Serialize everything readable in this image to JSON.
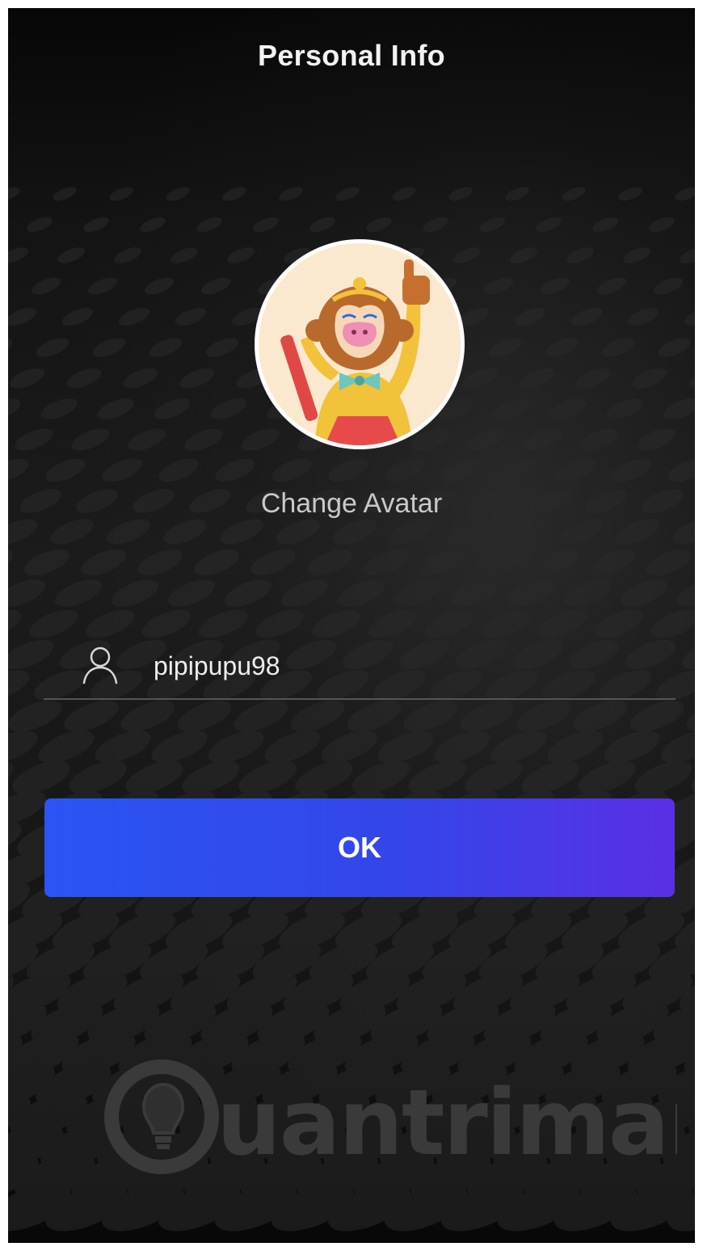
{
  "header": {
    "title": "Personal Info"
  },
  "avatar": {
    "alt": "monkey-king-avatar",
    "change_label": "Change Avatar"
  },
  "username_field": {
    "icon": "user-icon",
    "value": "pipipupu98"
  },
  "ok_button": {
    "label": "OK"
  },
  "watermark": {
    "text": "uantrimang",
    "icon": "lightbulb-icon"
  },
  "colors": {
    "background": "#151515",
    "button_start": "#2b54f4",
    "button_end": "#5a2fe4",
    "text_primary": "#f2f2f2",
    "text_secondary": "#c9c9c9",
    "divider": "#555555"
  }
}
